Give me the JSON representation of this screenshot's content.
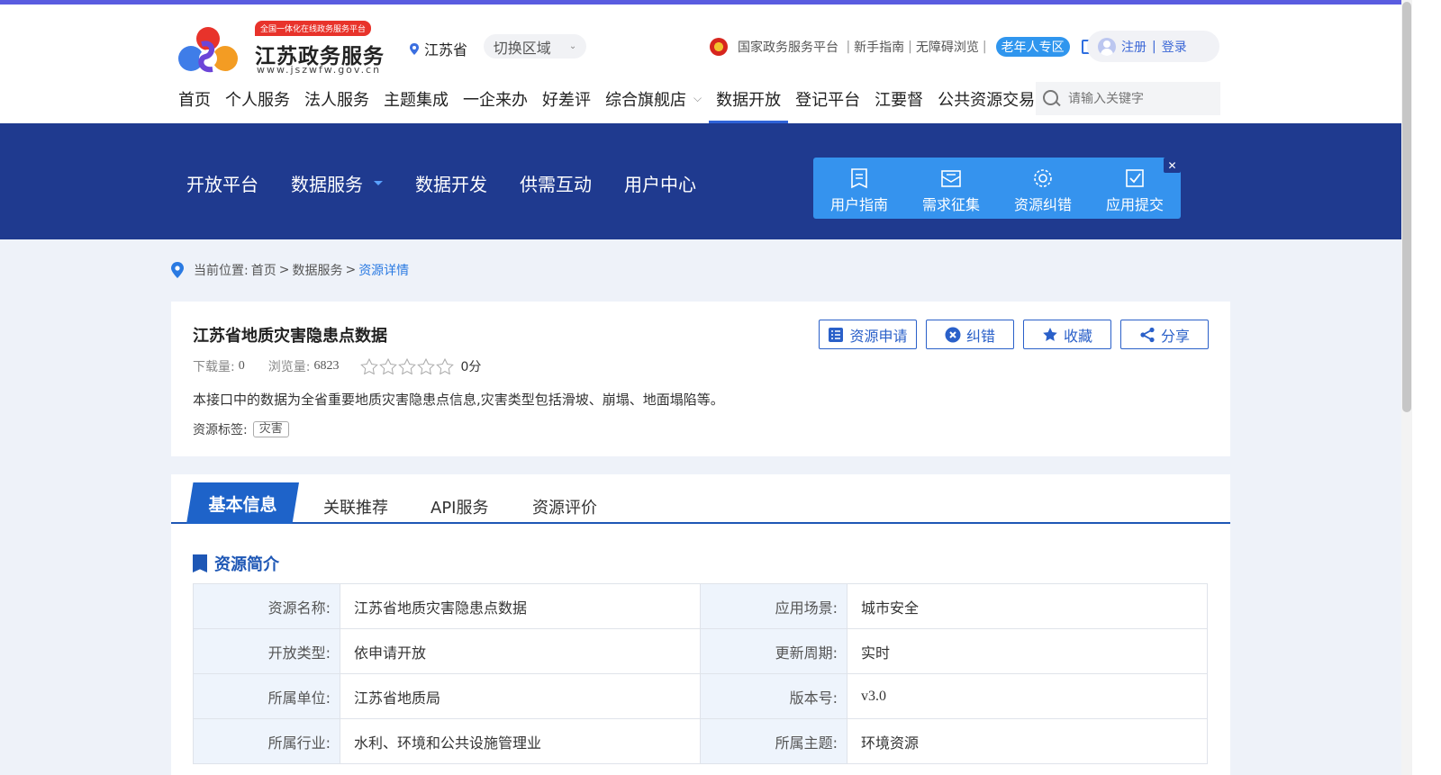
{
  "colors": {
    "accent": "#1e57b5",
    "banner": "#1f3a8f",
    "quick_panel": "#3593ee",
    "brand_red": "#e8332b"
  },
  "header": {
    "logo_badge": "全国一体化在线政务服务平台",
    "logo_title": "江苏政务服务",
    "logo_domain": "www.jszwfw.gov.cn",
    "region": "江苏省",
    "switch_region": "切换区域",
    "links": [
      "国家政务服务平台",
      "新手指南",
      "无障碍浏览"
    ],
    "elder_badge": "老年人专区",
    "register": "注册",
    "login_sep": "|",
    "login": "登录"
  },
  "mainnav": [
    "首页",
    "个人服务",
    "法人服务",
    "主题集成",
    "一企来办",
    "好差评",
    "综合旗舰店",
    "数据开放",
    "登记平台",
    "江要督",
    "公共资源交易"
  ],
  "search": {
    "placeholder": "请输入关键字"
  },
  "subnav": [
    "开放平台",
    "数据服务",
    "数据开发",
    "供需互动",
    "用户中心"
  ],
  "quick_panel": [
    "用户指南",
    "需求征集",
    "资源纠错",
    "应用提交"
  ],
  "breadcrumb": {
    "prefix": "当前位置:",
    "home": "首页",
    "sep": ">",
    "level2": "数据服务",
    "current": "资源详情"
  },
  "resource": {
    "title": "江苏省地质灾害隐患点数据",
    "downloads_label": "下载量:",
    "downloads": "0",
    "views_label": "浏览量:",
    "views": "6823",
    "rating": 0,
    "score": "0分",
    "description": "本接口中的数据为全省重要地质灾害隐患点信息,灾害类型包括滑坡、崩塌、地面塌陷等。",
    "tags_label": "资源标签:",
    "tag": "灾害",
    "actions": [
      "资源申请",
      "纠错",
      "收藏",
      "分享"
    ]
  },
  "tabs": [
    "基本信息",
    "关联推荐",
    "API服务",
    "资源评价"
  ],
  "section_title": "资源简介",
  "info_rows": [
    {
      "l1": "资源名称:",
      "v1": "江苏省地质灾害隐患点数据",
      "l2": "应用场景:",
      "v2": "城市安全"
    },
    {
      "l1": "开放类型:",
      "v1": "依申请开放",
      "l2": "更新周期:",
      "v2": "实时"
    },
    {
      "l1": "所属单位:",
      "v1": "江苏省地质局",
      "l2": "版本号:",
      "v2": "v3.0"
    },
    {
      "l1": "所属行业:",
      "v1": "水利、环境和公共设施管理业",
      "l2": "所属主题:",
      "v2": "环境资源"
    }
  ]
}
